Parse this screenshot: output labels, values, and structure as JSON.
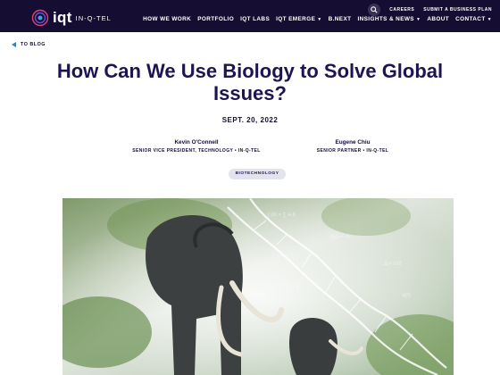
{
  "header": {
    "logo_text": "iqt",
    "logo_sub": "IN-Q-TEL",
    "utility_links": [
      "CAREERS",
      "SUBMIT A BUSINESS PLAN"
    ],
    "nav": [
      {
        "label": "HOW WE WORK",
        "dropdown": false
      },
      {
        "label": "PORTFOLIO",
        "dropdown": false
      },
      {
        "label": "IQT LABS",
        "dropdown": false
      },
      {
        "label": "IQT EMERGE",
        "dropdown": true
      },
      {
        "label": "B.NEXT",
        "dropdown": false
      },
      {
        "label": "INSIGHTS & NEWS",
        "dropdown": true
      },
      {
        "label": "ABOUT",
        "dropdown": false
      },
      {
        "label": "CONTACT",
        "dropdown": true
      }
    ]
  },
  "back_link": "TO BLOG",
  "article": {
    "title": "How Can We Use Biology to Solve Global Issues?",
    "date": "SEPT. 20, 2022",
    "authors": [
      {
        "name": "Kevin O'Connell",
        "role": "SENIOR VICE PRESIDENT, TECHNOLOGY • IN-Q-TEL"
      },
      {
        "name": "Eugene Chiu",
        "role": "SENIOR PARTNER • IN-Q-TEL"
      }
    ],
    "tag": "BIOTECHNOLOGY"
  },
  "colors": {
    "header_bg": "#160d33",
    "title": "#1d1551",
    "accent": "#1b8ad1",
    "tag_bg": "#e3e3ec"
  },
  "icons": {
    "search": "search-icon",
    "back": "arrow-left-icon",
    "dropdown": "chevron-down-icon"
  }
}
